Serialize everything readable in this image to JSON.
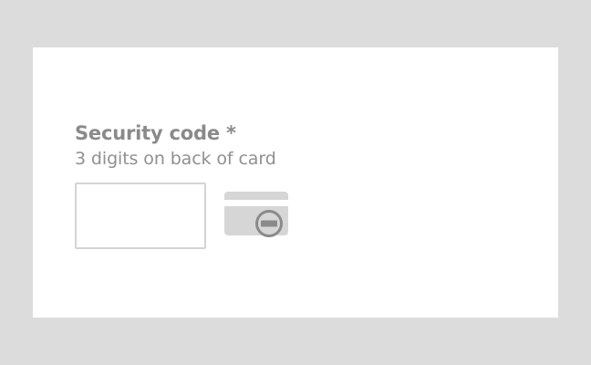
{
  "form": {
    "security_code_label": "Security code *",
    "security_code_hint": "3 digits on back of card",
    "security_code_value": "",
    "card_icon": "credit-card-back-cvc-icon"
  },
  "colors": {
    "background": "#dcdcdc",
    "panel": "#ffffff",
    "label": "#8a8a8a",
    "hint": "#909090",
    "input_border": "#d4d4d4",
    "icon": "#d6d6d6",
    "icon_badge_ring": "#8a8a8a"
  }
}
